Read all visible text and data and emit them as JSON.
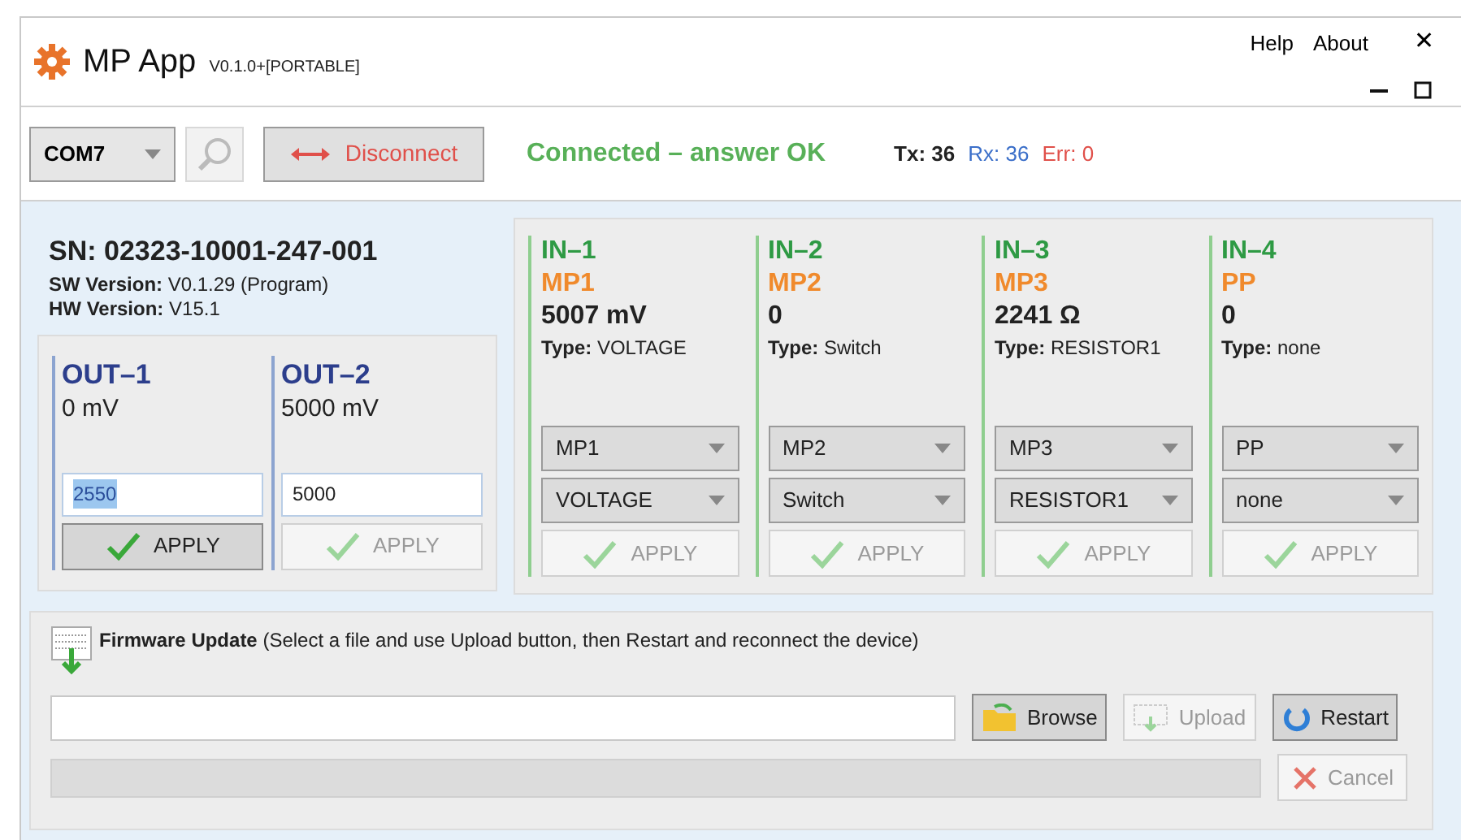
{
  "window": {
    "title": "MP App",
    "version": "V0.1.0+[PORTABLE]",
    "menu": [
      "Help",
      "About"
    ],
    "close": "✕"
  },
  "toolbar": {
    "port": "COM7",
    "disconnect": {
      "label": "Disconnect",
      "disabled": false
    },
    "status": "Connected – answer OK",
    "counters": [
      {
        "label": "Tx:",
        "value": "36",
        "color": "#222222"
      },
      {
        "label": "Rx:",
        "value": "36",
        "color": "#3b6fc9"
      },
      {
        "label": "Err:",
        "value": "0",
        "color": "#e0504a"
      }
    ]
  },
  "device": {
    "serial": "SN: 02323-10001-247-001",
    "info": [
      {
        "label": "SW Version:",
        "value": "V0.1.29 (Program)"
      },
      {
        "label": "HW Version:",
        "value": "V15.1"
      }
    ]
  },
  "outputs": [
    {
      "name": "OUT–1",
      "reading": "0 mV",
      "value": "2550",
      "highlighted": true,
      "apply": {
        "label": "APPLY",
        "disabled": false
      }
    },
    {
      "name": "OUT–2",
      "reading": "5000 mV",
      "value": "5000",
      "highlighted": false,
      "apply": {
        "label": "APPLY",
        "disabled": true
      }
    }
  ],
  "inputs": [
    {
      "name": "IN–1",
      "alias": "MP1",
      "reading": "5007 mV",
      "type_label": "Type:",
      "type": "VOLTAGE",
      "select_name": "MP1",
      "select_type": "VOLTAGE",
      "apply": {
        "label": "APPLY",
        "disabled": true
      }
    },
    {
      "name": "IN–2",
      "alias": "MP2",
      "reading": "0",
      "type_label": "Type:",
      "type": "Switch",
      "select_name": "MP2",
      "select_type": "Switch",
      "apply": {
        "label": "APPLY",
        "disabled": true
      }
    },
    {
      "name": "IN–3",
      "alias": "MP3",
      "reading": "2241 Ω",
      "type_label": "Type:",
      "type": "RESISTOR1",
      "select_name": "MP3",
      "select_type": "RESISTOR1",
      "apply": {
        "label": "APPLY",
        "disabled": true
      }
    },
    {
      "name": "IN–4",
      "alias": "PP",
      "reading": "0",
      "type_label": "Type:",
      "type": "none",
      "select_name": "PP",
      "select_type": "none",
      "apply": {
        "label": "APPLY",
        "disabled": true
      }
    }
  ],
  "firmware": {
    "description": "**Firmware Update** (Select a file and use Upload button, then Restart and reconnect the device)",
    "buttons": [
      {
        "kind": "browse",
        "label": "Browse",
        "disabled": false
      },
      {
        "kind": "upload",
        "label": "Upload",
        "disabled": true
      },
      {
        "kind": "restart",
        "label": "Restart",
        "disabled": false
      },
      {
        "kind": "cancel",
        "label": "Cancel",
        "disabled": true
      }
    ]
  }
}
